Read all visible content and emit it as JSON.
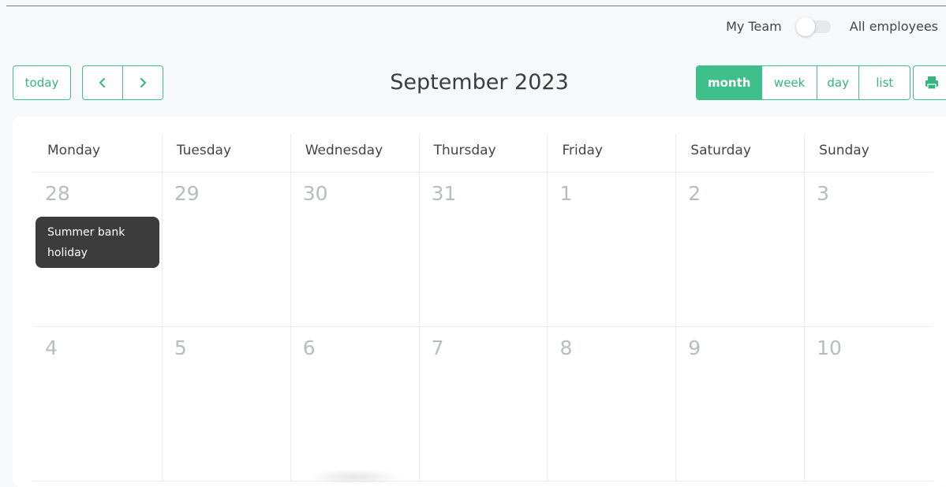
{
  "team_toggle": {
    "left_label": "My Team",
    "right_label": "All employees"
  },
  "toolbar": {
    "today_label": "today",
    "title": "September 2023",
    "views": [
      "month",
      "week",
      "day",
      "list"
    ],
    "active_view": "month"
  },
  "calendar": {
    "weekdays": [
      "Monday",
      "Tuesday",
      "Wednesday",
      "Thursday",
      "Friday",
      "Saturday",
      "Sunday"
    ],
    "weeks": [
      [
        "28",
        "29",
        "30",
        "31",
        "1",
        "2",
        "3"
      ],
      [
        "4",
        "5",
        "6",
        "7",
        "8",
        "9",
        "10"
      ]
    ],
    "event": {
      "title": "Summer bank holiday",
      "day": "28"
    }
  },
  "colors": {
    "accent": "#3fbf8c",
    "event_bg": "#3c3c3c",
    "day_number": "#b8bcc0"
  }
}
